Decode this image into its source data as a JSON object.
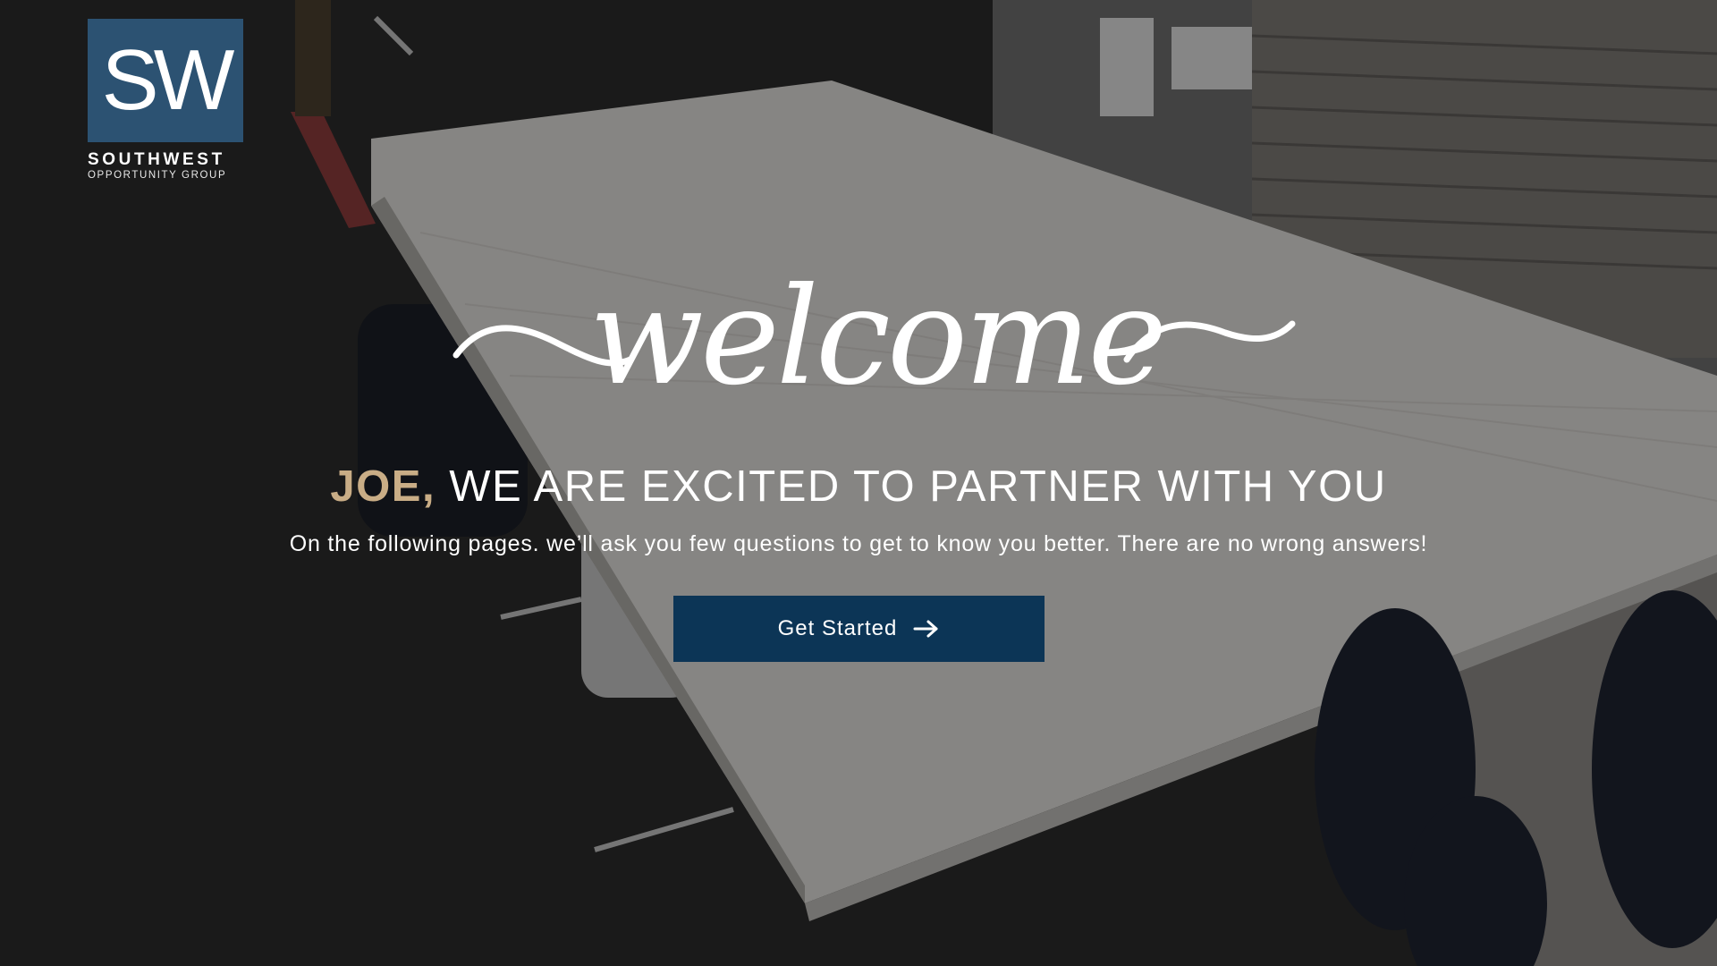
{
  "brand": {
    "logo_mark": "SW",
    "name": "SOUTHWEST",
    "subtitle": "OPPORTUNITY GROUP",
    "color": "#2c5272"
  },
  "hero": {
    "script_title": "welcome",
    "name": "JOE,",
    "headline": " WE ARE EXCITED TO PARTNER WITH YOU",
    "subtext": "On the following pages. we’ll ask you few questions to get to know you better. There are no wrong answers!",
    "name_color": "#c9ad86"
  },
  "cta": {
    "label": "Get Started",
    "icon": "arrow-right-icon",
    "color": "#0c3556"
  },
  "background": {
    "description_icon": "background-photo"
  }
}
